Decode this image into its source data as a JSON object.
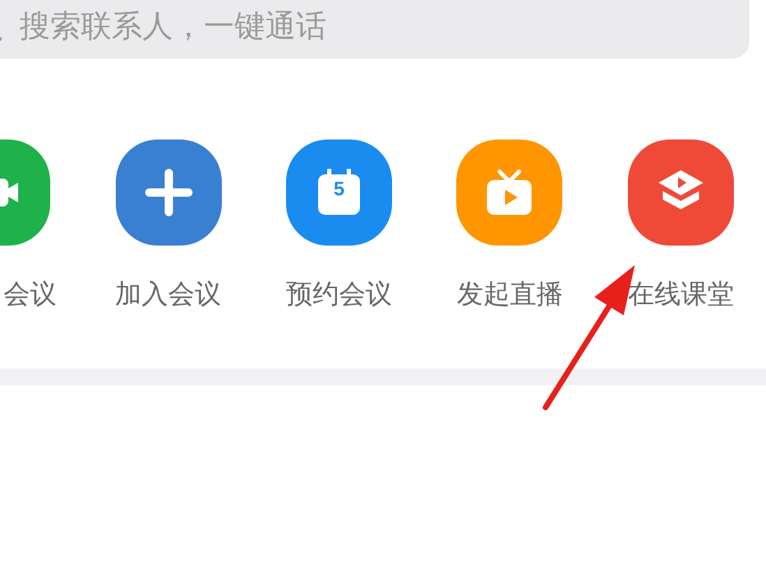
{
  "search": {
    "placeholder": "搜索联系人，一键通话"
  },
  "actions": [
    {
      "kind": "video",
      "label": "会议",
      "color": "#1fb24a"
    },
    {
      "kind": "join",
      "label": "加入会议",
      "color": "#3a80d2"
    },
    {
      "kind": "schedule",
      "label": "预约会议",
      "color": "#1a8cf0",
      "badge": "5"
    },
    {
      "kind": "live",
      "label": "发起直播",
      "color": "#ff9500"
    },
    {
      "kind": "classroom",
      "label": "在线课堂",
      "color": "#ef4a37"
    }
  ]
}
